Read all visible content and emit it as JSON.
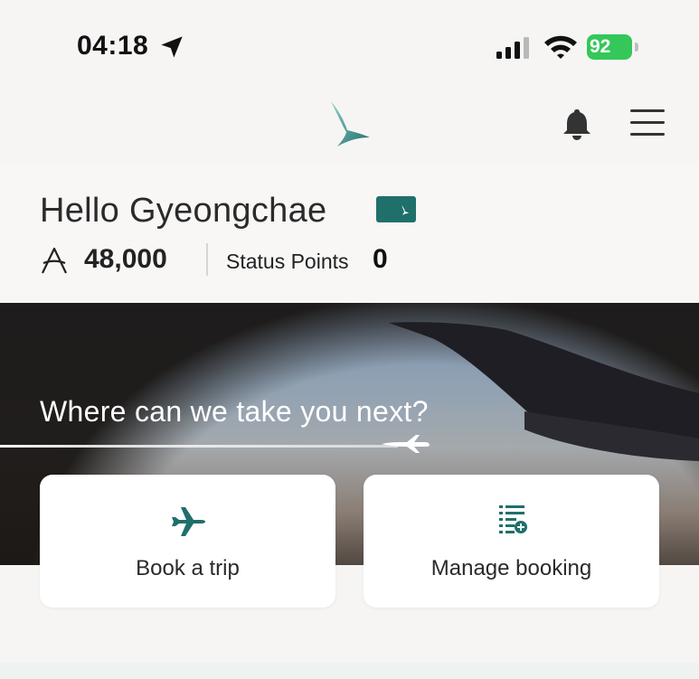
{
  "status_bar": {
    "time": "04:18",
    "battery": "92"
  },
  "header": {
    "logo": "cathay-logo",
    "icons": [
      "bell-icon",
      "menu-icon"
    ]
  },
  "greeting": {
    "hello": "Hello Gyeongchae",
    "miles": "48,000",
    "status_label": "Status Points",
    "status_value": "0"
  },
  "hero": {
    "title": "Where can we take you next?"
  },
  "actions": [
    {
      "label": "Book a trip",
      "icon": "plane-icon"
    },
    {
      "label": "Manage booking",
      "icon": "manage-booking-icon"
    }
  ],
  "colors": {
    "accent": "#1f6f6b",
    "battery": "#34c759",
    "background": "#f6f5f4"
  }
}
